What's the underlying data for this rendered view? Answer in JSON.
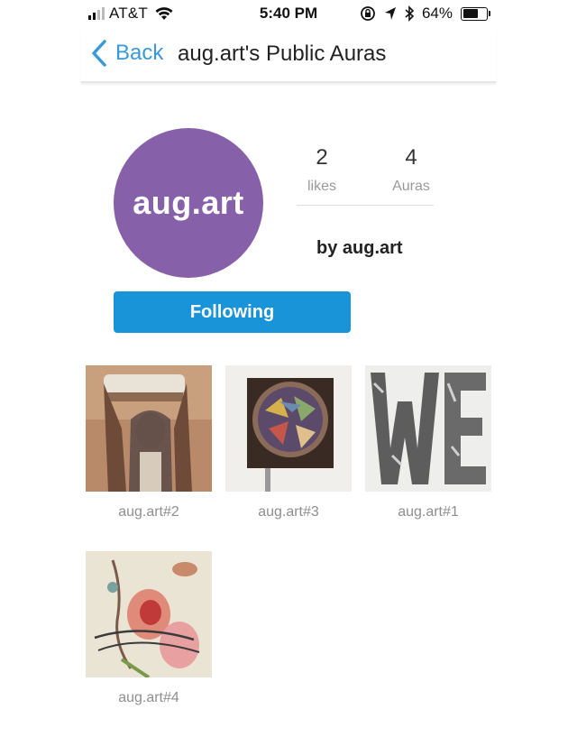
{
  "status_bar": {
    "carrier": "AT&T",
    "time": "5:40 PM",
    "battery_percent": "64%",
    "battery_level": 0.64,
    "icons": [
      "signal-icon",
      "wifi-icon",
      "orientation-lock-icon",
      "location-icon",
      "bluetooth-icon",
      "battery-icon"
    ]
  },
  "nav": {
    "back_label": "Back",
    "title": "aug.art's Public Auras"
  },
  "profile": {
    "avatar_text": "aug.art",
    "avatar_color": "#8660a8",
    "likes_count": "2",
    "likes_label": "likes",
    "auras_count": "4",
    "auras_label": "Auras",
    "byline": "by aug.art",
    "follow_label": "Following",
    "follow_color": "#1a94d9"
  },
  "auras": [
    {
      "label": "aug.art#2"
    },
    {
      "label": "aug.art#3"
    },
    {
      "label": "aug.art#1"
    },
    {
      "label": "aug.art#4"
    }
  ]
}
